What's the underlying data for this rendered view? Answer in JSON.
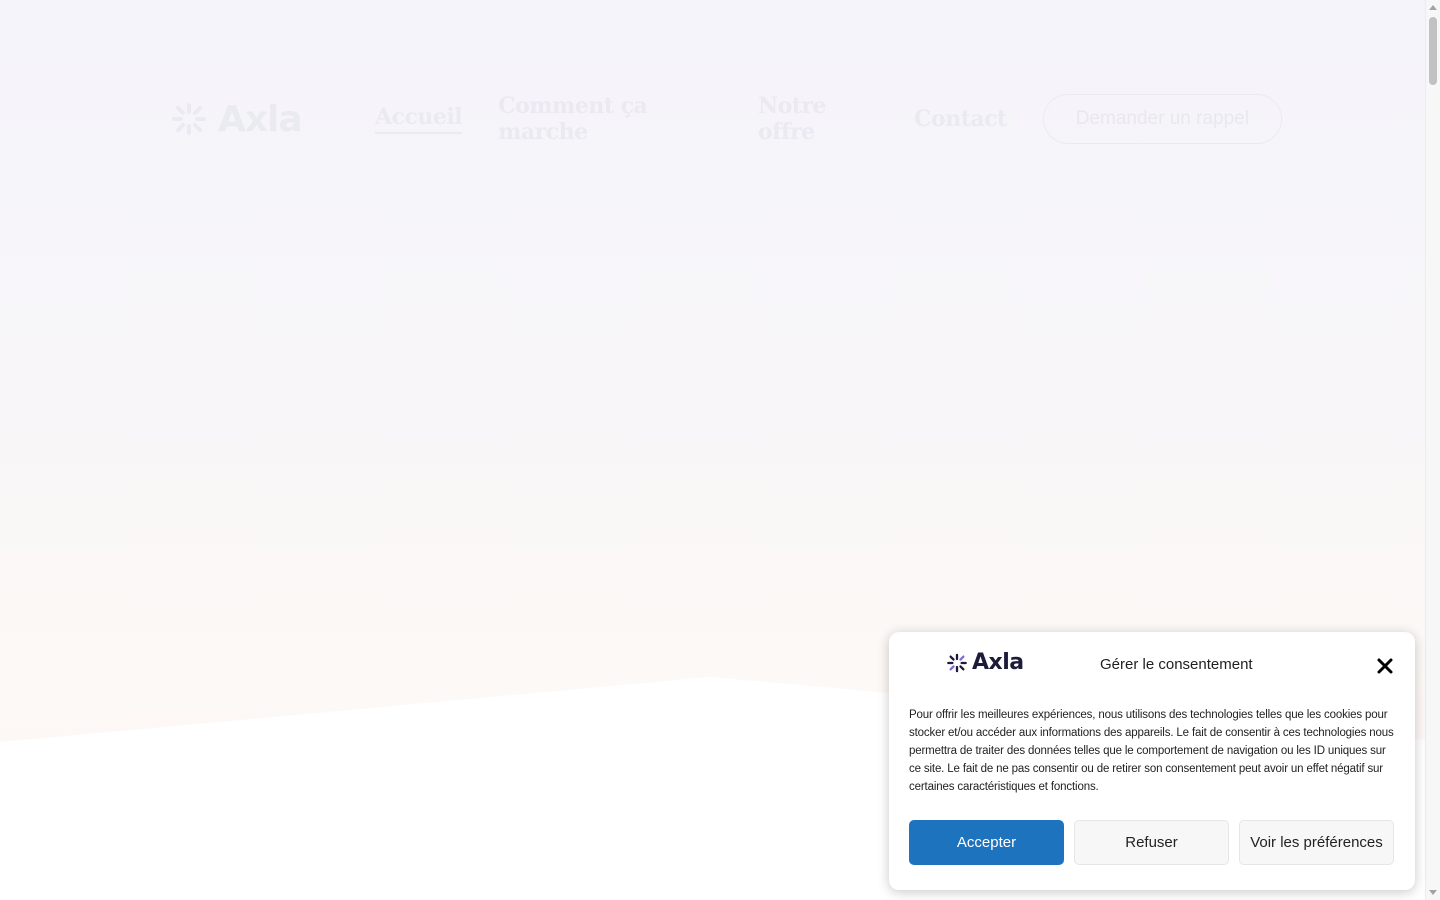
{
  "header": {
    "logo_text": "Axla",
    "nav": [
      {
        "label": "Accueil",
        "active": true
      },
      {
        "label": "Comment ça marche",
        "active": false
      },
      {
        "label": "Notre offre",
        "active": false
      },
      {
        "label": "Contact",
        "active": false
      }
    ],
    "cta_label": "Demander un rappel"
  },
  "consent": {
    "logo_text": "Axla",
    "title": "Gérer le consentement",
    "message": "Pour offrir les meilleures expériences, nous utilisons des technologies telles que les cookies pour stocker et/ou accéder aux informations des appareils. Le fait de consentir à ces technologies nous permettra de traiter des données telles que le comportement de navigation ou les ID uniques sur ce site. Le fait de ne pas consentir ou de retirer son consentement peut avoir un effet négatif sur certaines caractéristiques et fonctions.",
    "accept_label": "Accepter",
    "deny_label": "Refuser",
    "prefs_label": "Voir les préférences"
  },
  "colors": {
    "accent": "#1e73be",
    "brand_dark": "#1d1a3a"
  }
}
